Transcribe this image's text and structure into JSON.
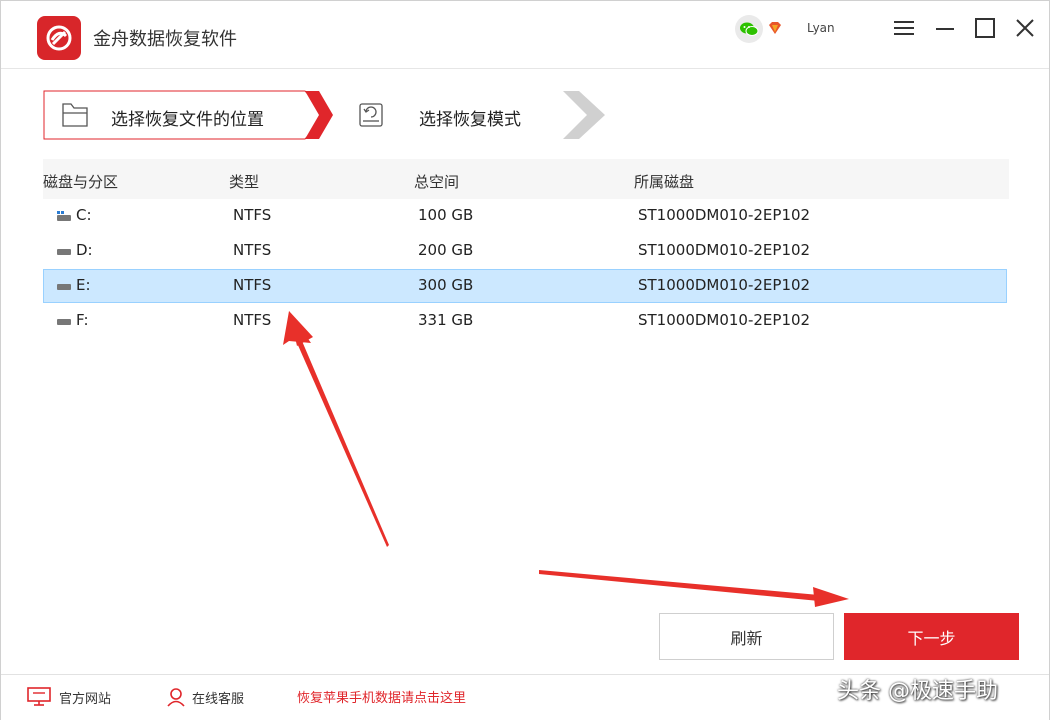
{
  "app": {
    "title": "金舟数据恢复软件",
    "username": "Lyan"
  },
  "steps": [
    {
      "label": "选择恢复文件的位置"
    },
    {
      "label": "选择恢复模式"
    }
  ],
  "table": {
    "headers": [
      "磁盘与分区",
      "类型",
      "总空间",
      "所属磁盘"
    ],
    "rows": [
      {
        "drive": "C:",
        "type": "NTFS",
        "size": "100 GB",
        "disk": "ST1000DM010-2EP102"
      },
      {
        "drive": "D:",
        "type": "NTFS",
        "size": "200 GB",
        "disk": "ST1000DM010-2EP102"
      },
      {
        "drive": "E:",
        "type": "NTFS",
        "size": "300 GB",
        "disk": "ST1000DM010-2EP102"
      },
      {
        "drive": "F:",
        "type": "NTFS",
        "size": "331 GB",
        "disk": "ST1000DM010-2EP102"
      }
    ]
  },
  "buttons": {
    "refresh": "刷新",
    "next": "下一步"
  },
  "footer": {
    "website": "官方网站",
    "support": "在线客服",
    "apple_link": "恢复苹果手机数据请点击这里"
  },
  "watermark": "头条 @极速手助",
  "colors": {
    "accent": "#e0262b",
    "selected_row": "#cce8ff"
  }
}
